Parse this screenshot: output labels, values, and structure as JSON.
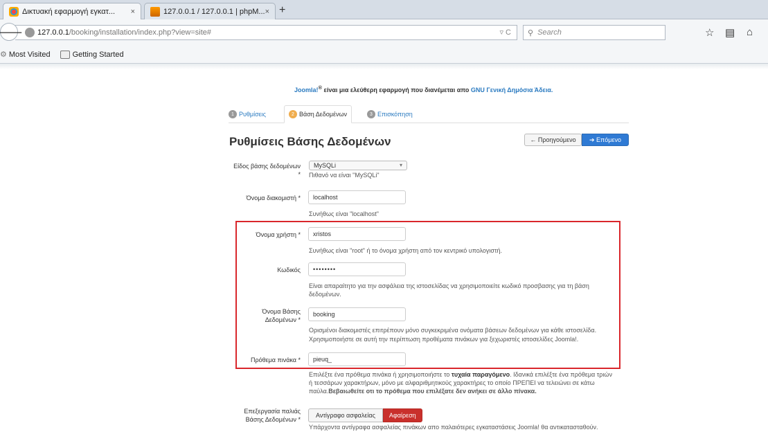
{
  "browser": {
    "tabs": [
      {
        "label": "Δικτυακή εφαρμογή εγκατ...",
        "close": "×"
      },
      {
        "label": "127.0.0.1 / 127.0.0.1 | phpM...",
        "close": "×"
      }
    ],
    "new_tab": "+",
    "url_host": "127.0.0.1",
    "url_path": "/booking/installation/index.php?view=site#",
    "search_placeholder": "Search",
    "bookmarks": [
      "Most Visited",
      "Getting Started"
    ]
  },
  "page": {
    "notice_pre": "Joomla!",
    "notice_sup": "®",
    "notice_mid": " είναι μια ελεύθερη εφαρμογή που διανέμεται απο ",
    "notice_link": "GNU Γενική Δημόσια Άδεια.",
    "steps": [
      {
        "num": "1",
        "label": "Ρυθμίσεις"
      },
      {
        "num": "2",
        "label": "Βάση Δεδομένων"
      },
      {
        "num": "3",
        "label": "Επισκόπηση"
      }
    ],
    "title": "Ρυθμίσεις Βάσης Δεδομένων",
    "prev_label": "← Προηγούμενο",
    "next_label": "➔ Επόμενο",
    "fields": {
      "db_type": {
        "label": "Είδος βάσης δεδομένων *",
        "value": "MySQLi",
        "help": "Πιθανό να είναι \"MySQLi\""
      },
      "host": {
        "label": "Όνομα διακομιστή *",
        "value": "localhost",
        "help": "Συνήθως είναι \"localhost\""
      },
      "user": {
        "label": "Όνομα χρήστη *",
        "value": "xristos",
        "help": "Συνήθως είναι \"root\" ή το όνομα χρήστη από τον κεντρικό υπολογιστή."
      },
      "password": {
        "label": "Κωδικός",
        "value": "••••••••",
        "help": "Είναι απαραίτητο για την ασφάλεια της ιστοσελίδας να χρησιμοποιείτε κωδικό προσβασης για τη βάση δεδομένων."
      },
      "db_name": {
        "label": "Όνομα Βάσης Δεδομένων *",
        "value": "booking",
        "help1": "Ορισμένοι διακομιστές επιτρέπουν μόνο συγκεκριμένα ονόματα βάσεων δεδομένων για κάθε ιστοσελίδα.",
        "help2": "Χρησιμοποιήστε σε αυτή την περίπτωση προθέματα πινάκων για ξεχωριστές ιστοσελίδες Joomla!."
      },
      "prefix": {
        "label": "Πρόθεμα πινάκα *",
        "value": "pieuq_",
        "help_a": "Επιλέξτε ένα πρόθεμα πινάκα ή χρησιμοποιήστε το ",
        "help_b": "τυχαία παραγόμενο",
        "help_c": ". Ιδανικά επιλέξτε ένα πρόθεμα τριών",
        "help2": "ή τεσσάρων χαρακτήρων, μόνο με αλφαριθμητικούς χαρακτήρες το οποίο ΠΡΕΠΕΙ να τελειώνει σε κάτω",
        "help3_a": "παύλα.",
        "help3_b": "Βεβαιωθείτε οτι το πρόθεμα που επιλέξατε δεν ανήκει σε άλλο πίνακα."
      },
      "old_db": {
        "label": "Επεξεργασία παλιάς Βάσης Δεδομένων *",
        "backup": "Αντίγραφο ασφαλείας",
        "remove": "Αφαίρεση",
        "help": "Υπάρχοντα αντίγραφα ασφαλείας πινάκων απο παλαιότερες εγκαταστάσεις Joomla! θα αντικατασταθούν."
      }
    }
  }
}
